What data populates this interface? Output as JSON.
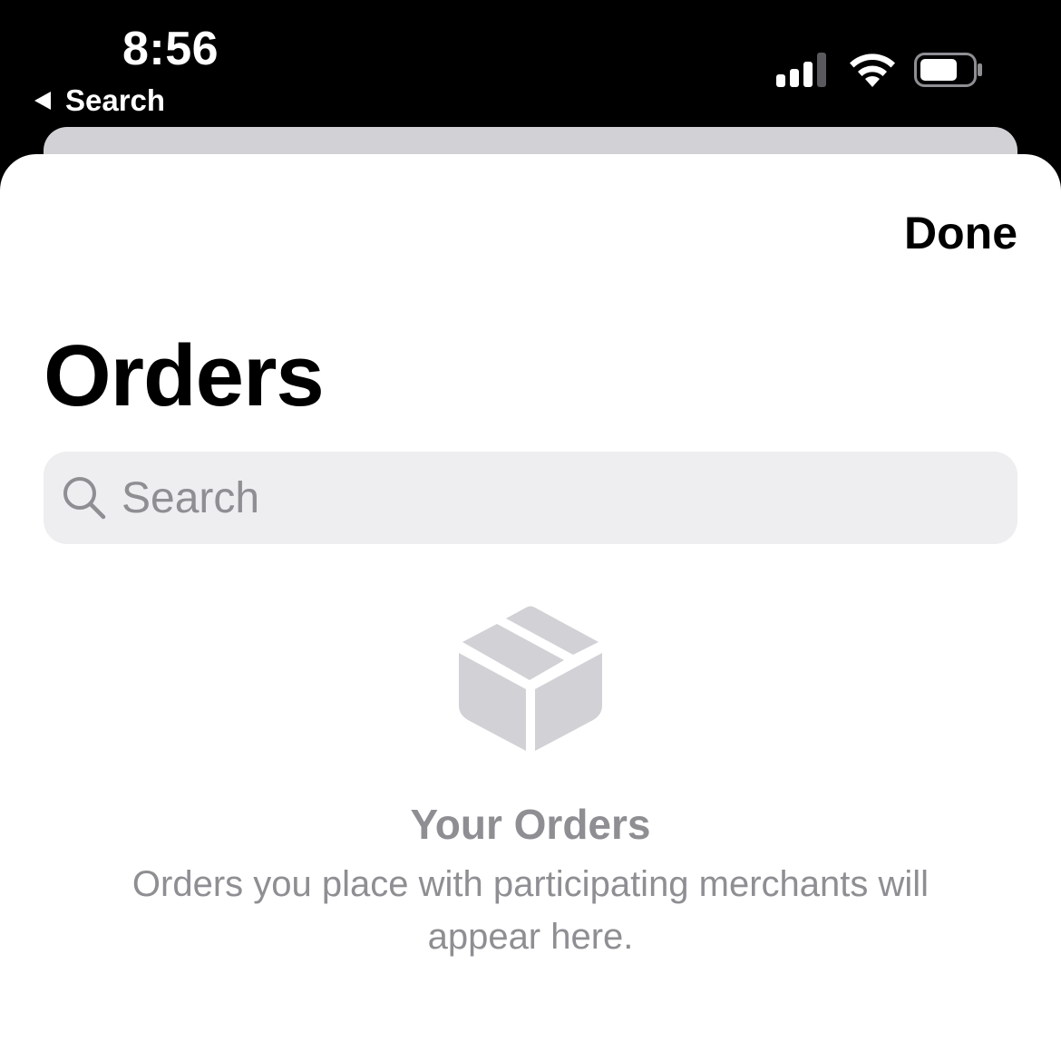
{
  "status_bar": {
    "time": "8:56",
    "back_label": "Search",
    "icons": [
      "cellular-signal-icon",
      "wifi-icon",
      "battery-icon"
    ]
  },
  "header": {
    "done_label": "Done",
    "title": "Orders"
  },
  "search": {
    "placeholder": "Search"
  },
  "empty_state": {
    "icon": "package-box-icon",
    "title": "Your Orders",
    "message": "Orders you place with participating merchants will appear here."
  },
  "colors": {
    "background": "#000000",
    "sheet": "#ffffff",
    "search_field": "#eeeef0",
    "secondary_text": "#8e8e93",
    "icon_gray": "#d1d1d6"
  }
}
